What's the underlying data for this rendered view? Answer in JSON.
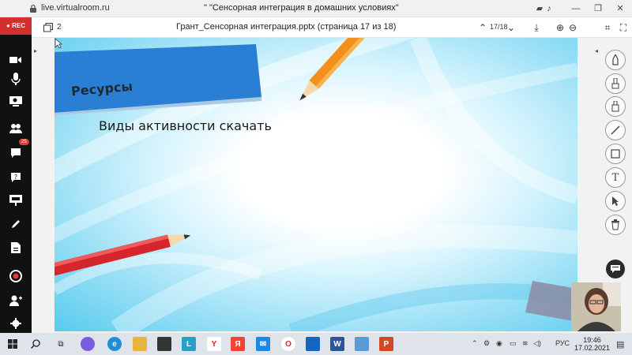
{
  "browser": {
    "url": "live.virtualroom.ru",
    "title": "\" \"Сенсорная интеграция в домашних условиях\""
  },
  "left_toolbar": {
    "rec_label": "REC",
    "participants_badge": "25"
  },
  "viewer": {
    "pages_count": "2",
    "file_title": "Грант_Сенсорная интеграция.pptx (страница 17 из 18)",
    "page_indicator": "17/18"
  },
  "slide": {
    "heading": "Ресурсы",
    "link_text": "Виды активности скачать"
  },
  "taskbar": {
    "language": "РУС",
    "time": "19:46",
    "date": "17.02.2021"
  },
  "colors": {
    "rec_red": "#d32f2f",
    "sidebar": "#111111",
    "banner_blue": "#2a7fd4",
    "pencil_orange": "#f3901d",
    "pencil_red": "#d7262b"
  }
}
